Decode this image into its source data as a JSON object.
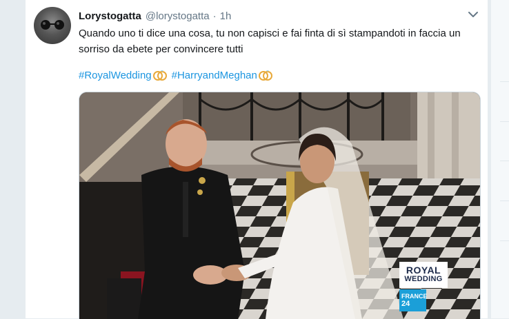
{
  "tweet": {
    "display_name": "Lorystogatta",
    "handle": "@lorystogatta",
    "separator": "·",
    "time": "1h",
    "text": "Quando uno ti dice una cosa, tu non capisci e fai finta di sì stampandoti in faccia un sorriso da ebete per convincere tutti",
    "hashtags": [
      {
        "label": "#RoyalWedding",
        "icon": "wedding-rings-emoji"
      },
      {
        "label": "#HarryandMeghan",
        "icon": "wedding-rings-emoji"
      }
    ]
  },
  "media": {
    "overlay": {
      "line1": "ROYAL",
      "line2": "WEDDING",
      "network_line1": "FRANCE",
      "network_line2": "24"
    }
  },
  "colors": {
    "link": "#1b95e0",
    "text": "#14171a",
    "muted": "#657786",
    "page_background": "#e6ecf0",
    "badge_blue": "#1b9fd8"
  }
}
